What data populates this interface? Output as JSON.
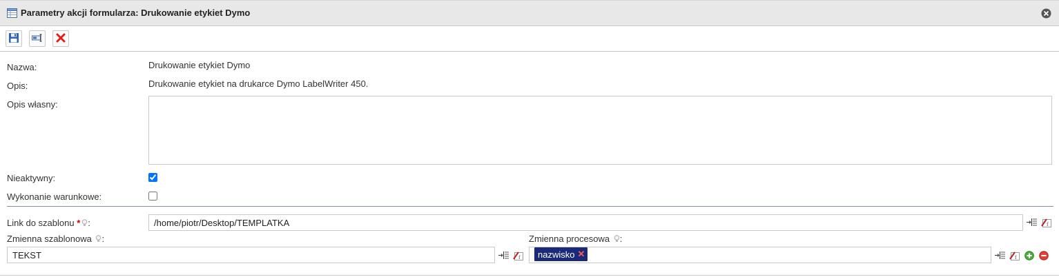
{
  "window": {
    "title": "Parametry akcji formularza: Drukowanie etykiet Dymo",
    "title_icon": "table-form-icon",
    "close_icon": "close-icon"
  },
  "toolbar": {
    "buttons": [
      {
        "name": "save",
        "icon": "floppy-disk-icon"
      },
      {
        "name": "rename",
        "icon": "text-field-icon"
      },
      {
        "name": "cancel",
        "icon": "red-x-icon"
      }
    ]
  },
  "form": {
    "name_label": "Nazwa:",
    "name_value": "Drukowanie etykiet Dymo",
    "description_label": "Opis:",
    "description_value": "Drukowanie etykiet na drukarce Dymo LabelWriter 450.",
    "own_description_label": "Opis własny:",
    "own_description_value": "",
    "inactive_label": "Nieaktywny:",
    "inactive_checked": true,
    "conditional_label": "Wykonanie warunkowe:",
    "conditional_checked": false
  },
  "params": {
    "template_link_label": "Link do szablonu",
    "template_link_required": "*",
    "template_link_value": "/home/piotr/Desktop/TEMPLATKA",
    "template_var_label": "Zmienna szablonowa",
    "template_var_value": "TEKST",
    "process_var_label": "Zmienna procesowa",
    "process_var_tags": [
      "nazwisko"
    ],
    "colon": ":"
  },
  "colors": {
    "title_bg": "#e8e8e8",
    "tag_bg": "#1b2a78",
    "separator": "#7a8fa5",
    "required": "#cc0000"
  }
}
